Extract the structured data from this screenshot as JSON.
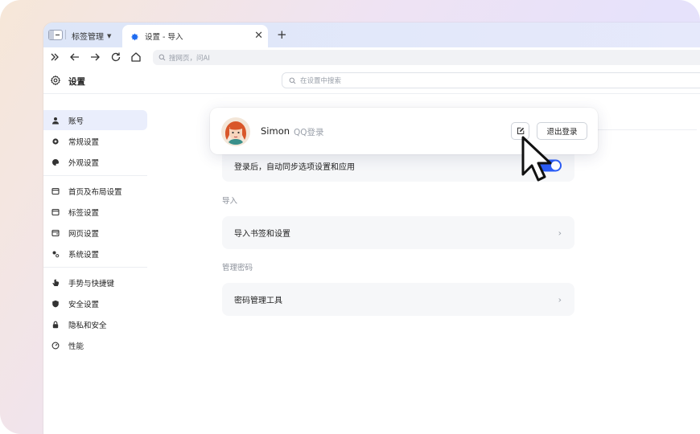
{
  "browser": {
    "tab_group_label": "标签管理",
    "active_tab_title": "设置 - 导入",
    "close_symbol": "✕",
    "new_tab_symbol": "+",
    "address_placeholder": "搜网页，问AI"
  },
  "settings": {
    "title": "设置",
    "search_placeholder": "在设置中搜索"
  },
  "sidebar": {
    "items": [
      {
        "label": "账号",
        "icon": "person-icon",
        "active": true
      },
      {
        "label": "常规设置",
        "icon": "gear-icon"
      },
      {
        "label": "外观设置",
        "icon": "palette-icon"
      },
      {
        "label": "首页及布局设置",
        "icon": "window-icon"
      },
      {
        "label": "标签设置",
        "icon": "tab-icon"
      },
      {
        "label": "网页设置",
        "icon": "webpage-icon"
      },
      {
        "label": "系统设置",
        "icon": "system-icon"
      },
      {
        "label": "手势与快捷键",
        "icon": "hand-pointer-icon"
      },
      {
        "label": "安全设置",
        "icon": "shield-icon"
      },
      {
        "label": "隐私和安全",
        "icon": "lock-icon"
      },
      {
        "label": "性能",
        "icon": "speedometer-icon"
      }
    ]
  },
  "account": {
    "name": "Simon",
    "type": "QQ登录",
    "logout_label": "退出登录"
  },
  "sync": {
    "label": "登录后，自动同步选项设置和应用",
    "enabled": true
  },
  "import_section": {
    "title": "导入",
    "item_label": "导入书签和设置"
  },
  "password_section": {
    "title": "管理密码",
    "item_label": "密码管理工具"
  },
  "colors": {
    "accent": "#2b5cf6",
    "sidebar_active_bg": "#eaeefc"
  }
}
